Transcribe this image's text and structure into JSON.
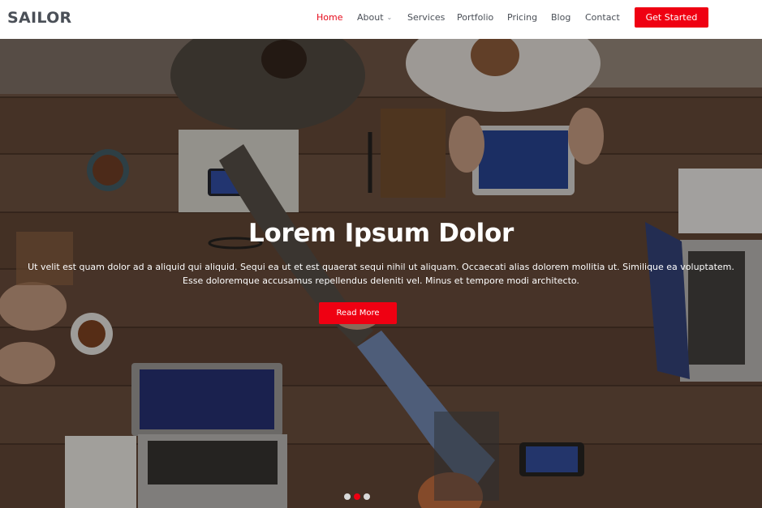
{
  "brand": {
    "name": "SAILOR"
  },
  "nav": {
    "items": [
      {
        "label": "Home",
        "active": true
      },
      {
        "label": "About",
        "dropdown": true
      },
      {
        "label": "Services"
      },
      {
        "label": "Portfolio"
      },
      {
        "label": "Pricing"
      },
      {
        "label": "Blog"
      },
      {
        "label": "Contact"
      }
    ],
    "cta_label": "Get Started"
  },
  "hero": {
    "title": "Lorem Ipsum Dolor",
    "text": "Ut velit est quam dolor ad a aliquid qui aliquid. Sequi ea ut et est quaerat sequi nihil ut aliquam. Occaecati alias dolorem mollitia ut. Similique ea voluptatem. Esse doloremque accusamus repellendus deleniti vel. Minus et tempore modi architecto.",
    "button_label": "Read More",
    "carousel": {
      "slides": 3,
      "active_index": 1
    }
  },
  "colors": {
    "accent": "#ef0012",
    "nav_active": "#e60a1b",
    "text_dark": "#4a4f57",
    "wood": "#5a4134"
  },
  "icons": {
    "dropdown": "chevron-down-icon"
  }
}
